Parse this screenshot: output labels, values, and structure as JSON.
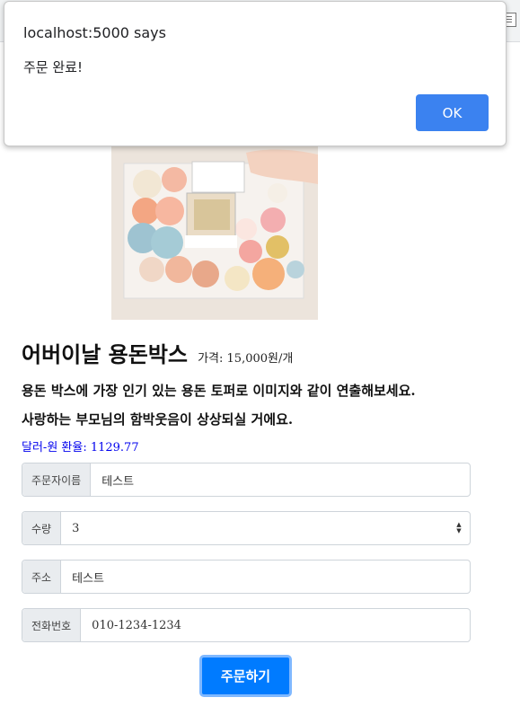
{
  "dialog": {
    "title": "localhost:5000 says",
    "message": "주문 완료!",
    "ok_label": "OK"
  },
  "product": {
    "title": "어버이날 용돈박스",
    "price": "가격: 15,000원/개",
    "description_1": "용돈 박스에 가장 인기 있는 용돈 토퍼로 이미지와 같이 연출해보세요.",
    "description_2": "사랑하는 부모님의 함박웃음이 상상되실 거에요.",
    "exchange_rate": "달러-원 환율: 1129.77"
  },
  "form": {
    "name_label": "주문자이름",
    "name_value": "테스트",
    "quantity_label": "수량",
    "quantity_value": "3",
    "address_label": "주소",
    "address_value": "테스트",
    "phone_label": "전화번호",
    "phone_value": "010-1234-1234",
    "submit_label": "주문하기"
  }
}
